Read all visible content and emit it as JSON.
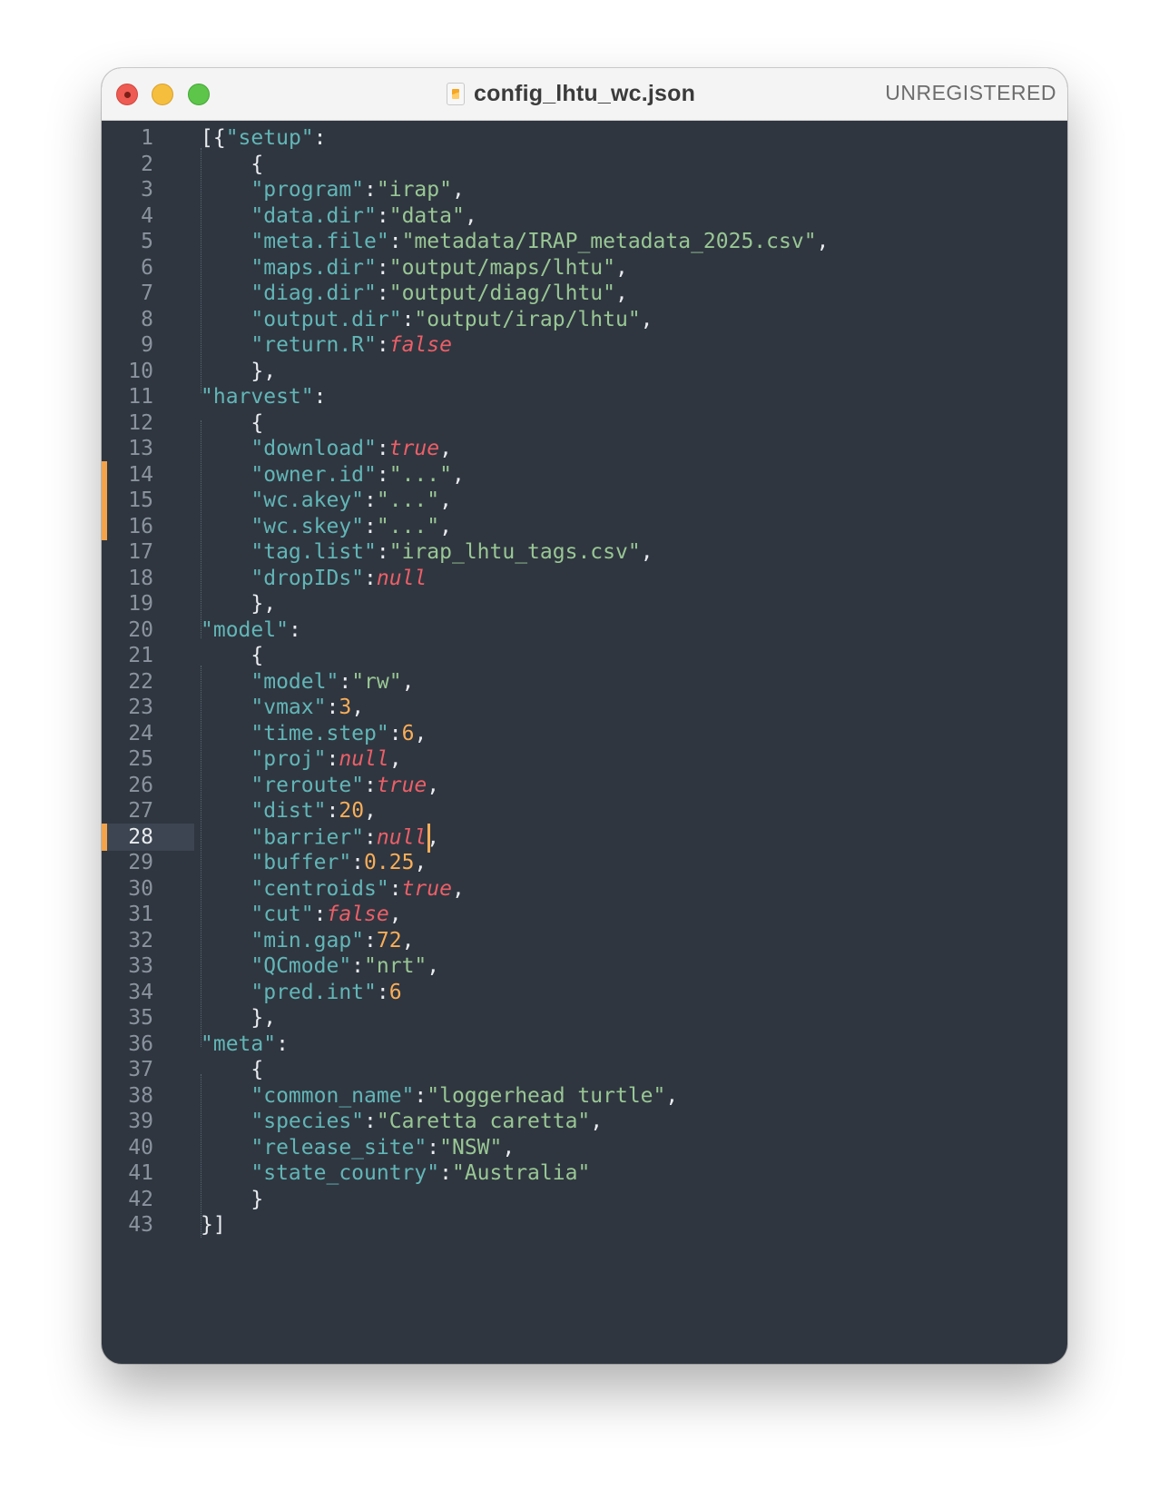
{
  "window": {
    "title": "config_lhtu_wc.json",
    "status": "UNREGISTERED",
    "file_icon": "sublime-file-icon"
  },
  "editor": {
    "active_line": 28,
    "modified_lines": [
      14,
      15,
      16,
      28
    ],
    "colors": {
      "background": "#2f3640",
      "key": "#62b6b7",
      "string": "#99c794",
      "number": "#f9ae58",
      "boolean": "#ec5f67",
      "punct": "#e9ecef",
      "modified_marker": "#f3a34a"
    },
    "lines": [
      {
        "n": "1",
        "tokens": [
          [
            "p",
            "[{"
          ],
          [
            "k",
            "\"setup\""
          ],
          [
            "p",
            ":"
          ]
        ]
      },
      {
        "n": "2",
        "tokens": [
          [
            "p",
            "    {"
          ]
        ]
      },
      {
        "n": "3",
        "tokens": [
          [
            "p",
            "    "
          ],
          [
            "k",
            "\"program\""
          ],
          [
            "p",
            ":"
          ],
          [
            "s",
            "\"irap\""
          ],
          [
            "p",
            ","
          ]
        ]
      },
      {
        "n": "4",
        "tokens": [
          [
            "p",
            "    "
          ],
          [
            "k",
            "\"data.dir\""
          ],
          [
            "p",
            ":"
          ],
          [
            "s",
            "\"data\""
          ],
          [
            "p",
            ","
          ]
        ]
      },
      {
        "n": "5",
        "tokens": [
          [
            "p",
            "    "
          ],
          [
            "k",
            "\"meta.file\""
          ],
          [
            "p",
            ":"
          ],
          [
            "s",
            "\"metadata/IRAP_metadata_2025.csv\""
          ],
          [
            "p",
            ","
          ]
        ]
      },
      {
        "n": "6",
        "tokens": [
          [
            "p",
            "    "
          ],
          [
            "k",
            "\"maps.dir\""
          ],
          [
            "p",
            ":"
          ],
          [
            "s",
            "\"output/maps/lhtu\""
          ],
          [
            "p",
            ","
          ]
        ]
      },
      {
        "n": "7",
        "tokens": [
          [
            "p",
            "    "
          ],
          [
            "k",
            "\"diag.dir\""
          ],
          [
            "p",
            ":"
          ],
          [
            "s",
            "\"output/diag/lhtu\""
          ],
          [
            "p",
            ","
          ]
        ]
      },
      {
        "n": "8",
        "tokens": [
          [
            "p",
            "    "
          ],
          [
            "k",
            "\"output.dir\""
          ],
          [
            "p",
            ":"
          ],
          [
            "s",
            "\"output/irap/lhtu\""
          ],
          [
            "p",
            ","
          ]
        ]
      },
      {
        "n": "9",
        "tokens": [
          [
            "p",
            "    "
          ],
          [
            "k",
            "\"return.R\""
          ],
          [
            "p",
            ":"
          ],
          [
            "b",
            "false"
          ]
        ]
      },
      {
        "n": "10",
        "tokens": [
          [
            "p",
            "    },"
          ]
        ]
      },
      {
        "n": "11",
        "tokens": [
          [
            "k",
            "\"harvest\""
          ],
          [
            "p",
            ":"
          ]
        ]
      },
      {
        "n": "12",
        "tokens": [
          [
            "p",
            "    {"
          ]
        ]
      },
      {
        "n": "13",
        "tokens": [
          [
            "p",
            "    "
          ],
          [
            "k",
            "\"download\""
          ],
          [
            "p",
            ":"
          ],
          [
            "b",
            "true"
          ],
          [
            "p",
            ","
          ]
        ]
      },
      {
        "n": "14",
        "tokens": [
          [
            "p",
            "    "
          ],
          [
            "k",
            "\"owner.id\""
          ],
          [
            "p",
            ":"
          ],
          [
            "s",
            "\"...\""
          ],
          [
            "p",
            ","
          ]
        ]
      },
      {
        "n": "15",
        "tokens": [
          [
            "p",
            "    "
          ],
          [
            "k",
            "\"wc.akey\""
          ],
          [
            "p",
            ":"
          ],
          [
            "s",
            "\"...\""
          ],
          [
            "p",
            ","
          ]
        ]
      },
      {
        "n": "16",
        "tokens": [
          [
            "p",
            "    "
          ],
          [
            "k",
            "\"wc.skey\""
          ],
          [
            "p",
            ":"
          ],
          [
            "s",
            "\"...\""
          ],
          [
            "p",
            ","
          ]
        ]
      },
      {
        "n": "17",
        "tokens": [
          [
            "p",
            "    "
          ],
          [
            "k",
            "\"tag.list\""
          ],
          [
            "p",
            ":"
          ],
          [
            "s",
            "\"irap_lhtu_tags.csv\""
          ],
          [
            "p",
            ","
          ]
        ]
      },
      {
        "n": "18",
        "tokens": [
          [
            "p",
            "    "
          ],
          [
            "k",
            "\"dropIDs\""
          ],
          [
            "p",
            ":"
          ],
          [
            "b",
            "null"
          ]
        ]
      },
      {
        "n": "19",
        "tokens": [
          [
            "p",
            "    },"
          ]
        ]
      },
      {
        "n": "20",
        "tokens": [
          [
            "k",
            "\"model\""
          ],
          [
            "p",
            ":"
          ]
        ]
      },
      {
        "n": "21",
        "tokens": [
          [
            "p",
            "    {"
          ]
        ]
      },
      {
        "n": "22",
        "tokens": [
          [
            "p",
            "    "
          ],
          [
            "k",
            "\"model\""
          ],
          [
            "p",
            ":"
          ],
          [
            "s",
            "\"rw\""
          ],
          [
            "p",
            ","
          ]
        ]
      },
      {
        "n": "23",
        "tokens": [
          [
            "p",
            "    "
          ],
          [
            "k",
            "\"vmax\""
          ],
          [
            "p",
            ":"
          ],
          [
            "n",
            "3"
          ],
          [
            "p",
            ","
          ]
        ]
      },
      {
        "n": "24",
        "tokens": [
          [
            "p",
            "    "
          ],
          [
            "k",
            "\"time.step\""
          ],
          [
            "p",
            ":"
          ],
          [
            "n",
            "6"
          ],
          [
            "p",
            ","
          ]
        ]
      },
      {
        "n": "25",
        "tokens": [
          [
            "p",
            "    "
          ],
          [
            "k",
            "\"proj\""
          ],
          [
            "p",
            ":"
          ],
          [
            "b",
            "null"
          ],
          [
            "p",
            ","
          ]
        ]
      },
      {
        "n": "26",
        "tokens": [
          [
            "p",
            "    "
          ],
          [
            "k",
            "\"reroute\""
          ],
          [
            "p",
            ":"
          ],
          [
            "b",
            "true"
          ],
          [
            "p",
            ","
          ]
        ]
      },
      {
        "n": "27",
        "tokens": [
          [
            "p",
            "    "
          ],
          [
            "k",
            "\"dist\""
          ],
          [
            "p",
            ":"
          ],
          [
            "n",
            "20"
          ],
          [
            "p",
            ","
          ]
        ]
      },
      {
        "n": "28",
        "tokens": [
          [
            "p",
            "    "
          ],
          [
            "k",
            "\"barrier\""
          ],
          [
            "p",
            ":"
          ],
          [
            "b",
            "null"
          ],
          [
            "p",
            ","
          ]
        ]
      },
      {
        "n": "29",
        "tokens": [
          [
            "p",
            "    "
          ],
          [
            "k",
            "\"buffer\""
          ],
          [
            "p",
            ":"
          ],
          [
            "n",
            "0.25"
          ],
          [
            "p",
            ","
          ]
        ]
      },
      {
        "n": "30",
        "tokens": [
          [
            "p",
            "    "
          ],
          [
            "k",
            "\"centroids\""
          ],
          [
            "p",
            ":"
          ],
          [
            "b",
            "true"
          ],
          [
            "p",
            ","
          ]
        ]
      },
      {
        "n": "31",
        "tokens": [
          [
            "p",
            "    "
          ],
          [
            "k",
            "\"cut\""
          ],
          [
            "p",
            ":"
          ],
          [
            "b",
            "false"
          ],
          [
            "p",
            ","
          ]
        ]
      },
      {
        "n": "32",
        "tokens": [
          [
            "p",
            "    "
          ],
          [
            "k",
            "\"min.gap\""
          ],
          [
            "p",
            ":"
          ],
          [
            "n",
            "72"
          ],
          [
            "p",
            ","
          ]
        ]
      },
      {
        "n": "33",
        "tokens": [
          [
            "p",
            "    "
          ],
          [
            "k",
            "\"QCmode\""
          ],
          [
            "p",
            ":"
          ],
          [
            "s",
            "\"nrt\""
          ],
          [
            "p",
            ","
          ]
        ]
      },
      {
        "n": "34",
        "tokens": [
          [
            "p",
            "    "
          ],
          [
            "k",
            "\"pred.int\""
          ],
          [
            "p",
            ":"
          ],
          [
            "n",
            "6"
          ]
        ]
      },
      {
        "n": "35",
        "tokens": [
          [
            "p",
            "    },"
          ]
        ]
      },
      {
        "n": "36",
        "tokens": [
          [
            "k",
            "\"meta\""
          ],
          [
            "p",
            ":"
          ]
        ]
      },
      {
        "n": "37",
        "tokens": [
          [
            "p",
            "    {"
          ]
        ]
      },
      {
        "n": "38",
        "tokens": [
          [
            "p",
            "    "
          ],
          [
            "k",
            "\"common_name\""
          ],
          [
            "p",
            ":"
          ],
          [
            "s",
            "\"loggerhead turtle\""
          ],
          [
            "p",
            ","
          ]
        ]
      },
      {
        "n": "39",
        "tokens": [
          [
            "p",
            "    "
          ],
          [
            "k",
            "\"species\""
          ],
          [
            "p",
            ":"
          ],
          [
            "s",
            "\"Caretta caretta\""
          ],
          [
            "p",
            ","
          ]
        ]
      },
      {
        "n": "40",
        "tokens": [
          [
            "p",
            "    "
          ],
          [
            "k",
            "\"release_site\""
          ],
          [
            "p",
            ":"
          ],
          [
            "s",
            "\"NSW\""
          ],
          [
            "p",
            ","
          ]
        ]
      },
      {
        "n": "41",
        "tokens": [
          [
            "p",
            "    "
          ],
          [
            "k",
            "\"state_country\""
          ],
          [
            "p",
            ":"
          ],
          [
            "s",
            "\"Australia\""
          ]
        ]
      },
      {
        "n": "42",
        "tokens": [
          [
            "p",
            "    }"
          ]
        ]
      },
      {
        "n": "43",
        "tokens": [
          [
            "p",
            "}]"
          ]
        ]
      }
    ]
  }
}
